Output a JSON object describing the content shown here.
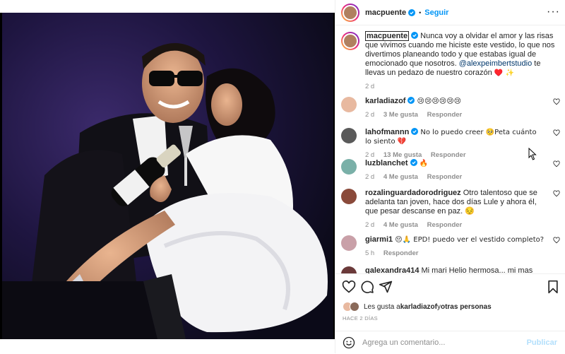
{
  "post": {
    "author": "macpuente",
    "follow_label": "Seguir",
    "dot": "•",
    "more": "···",
    "caption_author": "macpuente",
    "caption_text": " Nunca voy a olvidar el amor y las risas que vivimos cuando me hiciste este vestido, lo que nos divertimos planeando todo y que estabas igual de emocionado que nosotros. ",
    "caption_mention": "@alexpeimbertstudio",
    "caption_tail": " te llevas un pedazo de nuestro corazón ",
    "caption_emoji": "♥️ ✨",
    "caption_time": "2 d"
  },
  "comments": [
    {
      "user": "karladiazof",
      "verified": true,
      "text": "😢😢😢😢😢😢",
      "time": "2 d",
      "likes": "3 Me gusta",
      "reply": "Responder",
      "avatar_color": "#e8b9a0"
    },
    {
      "user": "lahofmannn",
      "verified": true,
      "text": "No lo puedo creer 🥺Peta cuánto lo siento 💔",
      "time": "2 d",
      "likes": "13 Me gusta",
      "reply": "Responder",
      "avatar_color": "#5a5a5a"
    },
    {
      "user": "luzblanchet",
      "verified": true,
      "text": "🔥",
      "time": "2 d",
      "likes": "4 Me gusta",
      "reply": "Responder",
      "avatar_color": "#7ab0a8"
    },
    {
      "user": "rozalinguardadorodriguez",
      "verified": false,
      "text": "Otro talentoso que se adelanta tan joven, hace dos días Lule y ahora él, que pesar descanse en paz. 😔",
      "time": "2 d",
      "likes": "4 Me gusta",
      "reply": "Responder",
      "avatar_color": "#8a4a3a"
    },
    {
      "user": "giarmi1",
      "verified": false,
      "text": "😔🙏 EPD! puedo ver el vestido completo?",
      "time": "5 h",
      "likes": "",
      "reply": "Responder",
      "avatar_color": "#c9a0a8"
    },
    {
      "user": "galexandra414",
      "verified": false,
      "text": "Mi mari Helio hermosa... mi mas sentido",
      "time": "",
      "likes": "",
      "reply": "",
      "avatar_color": "#6b3a3a"
    }
  ],
  "likes_line": {
    "prefix": "Les gusta a ",
    "user": "karladiazof",
    "middle": " y ",
    "others": "otras personas"
  },
  "time_ago": "HACE 2 DÍAS",
  "comment_input": {
    "placeholder": "Agrega un comentario...",
    "value": ""
  },
  "publish_label": "Publicar",
  "colors": {
    "accent": "#0095f6",
    "verified": "#0095f6",
    "heart": "#ed4956"
  },
  "icons": [
    "heart-icon",
    "comment-icon",
    "share-icon",
    "bookmark-icon",
    "smile-icon",
    "verified-icon",
    "more-icon"
  ]
}
